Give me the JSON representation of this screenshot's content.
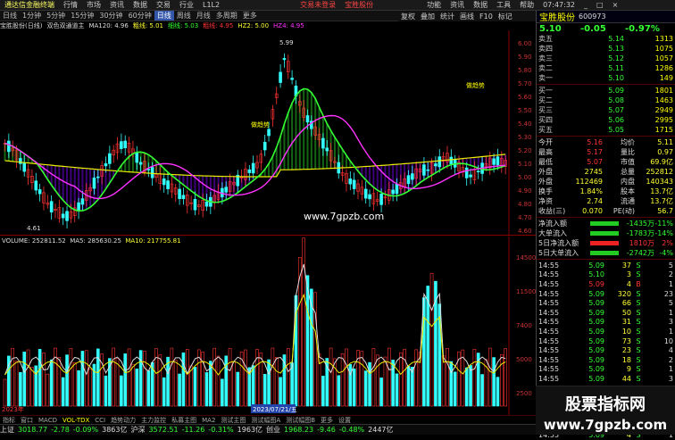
{
  "titlebar": {
    "app": "通达信金融终端",
    "menus": [
      "行情",
      "市场",
      "资讯",
      "数据",
      "交易",
      "行业",
      "L1L2"
    ],
    "promo1": "交易未登录",
    "promo2": "宝胜股份",
    "right_items": [
      "功能",
      "资讯",
      "数据",
      "工具",
      "帮助"
    ],
    "clock": "07:47:32"
  },
  "periodbar": {
    "items": [
      "日线",
      "1分钟",
      "5分钟",
      "15分钟",
      "30分钟",
      "60分钟",
      "日线",
      "周线",
      "月线",
      "多周期",
      "更多"
    ],
    "active_index": 6,
    "right_items": [
      "复权",
      "叠加",
      "统计",
      "画线",
      "F10",
      "标记"
    ]
  },
  "indicator_line": {
    "stock": "宝胜股份(日线)",
    "formula": "双色双通道主",
    "ma": "MA120: 4.96",
    "i1": "粗线: 5.01",
    "i2": "细线: 5.03",
    "i3": "粗线: 4.95",
    "i4": "HZ2: 5.00",
    "i5": "HZ4: 4.95"
  },
  "chart_labels": {
    "high": "5.99",
    "low": "4.61",
    "annot1": "做趋势",
    "annot2": "做趋势",
    "watermark": "www.7gpzb.com",
    "price_axis": [
      "6.00",
      "5.90",
      "5.80",
      "5.70",
      "5.60",
      "5.50",
      "5.40",
      "5.30",
      "5.20",
      "5.10",
      "5.00",
      "4.90",
      "4.80",
      "4.70",
      "4.60"
    ]
  },
  "volume": {
    "label": "VOLUME: 252811.52",
    "ma5": "MA5: 285630.25",
    "ma10": "MA10: 217755.81",
    "axis": [
      "14500",
      "11500",
      "7400",
      "5000",
      "2500"
    ],
    "axis_pos": [
      "14500",
      "1530",
      "11500",
      "10000",
      "7500",
      "5000",
      "2500"
    ],
    "date_label": "2023/07/21/五",
    "year": "2023年"
  },
  "bottom_tabs": [
    "指标",
    "窗口",
    "MACD",
    "VOL-TDX",
    "CCI",
    "趋势动力",
    "主力监控",
    "私募主图",
    "MA2",
    "测试主图",
    "测试幅图A",
    "测试幅图B",
    "更多",
    "设置"
  ],
  "bottom_tabs2": [
    "扩展A",
    "关联板块",
    "资金分布",
    "综合资讯",
    "行业资讯",
    "互动问答",
    "普及新功能说明"
  ],
  "statusbar": {
    "sh_label": "上证",
    "sh_val": "3018.77",
    "sh_chg": "-2.78",
    "sh_pct": "-0.09%",
    "sh_amt": "3863亿",
    "sz_label": "沪深",
    "sz_val": "3572.51",
    "sz_chg": "-11.26",
    "sz_pct": "-0.31%",
    "sz_amt": "1963亿",
    "cy_label": "创业",
    "cy_val": "1968.23",
    "cy_chg": "-9.46",
    "cy_pct": "-0.48%",
    "cy_amt": "2447亿",
    "right": "平安证券新疆云行情"
  },
  "quote": {
    "name": "宝胜股份",
    "code": "600973",
    "price": "5.10",
    "change": "-0.05",
    "pct": "-0.97%",
    "asks": [
      {
        "label": "卖五",
        "price": "5.14",
        "vol": "1313"
      },
      {
        "label": "卖四",
        "price": "5.13",
        "vol": "1075"
      },
      {
        "label": "卖三",
        "price": "5.12",
        "vol": "1057"
      },
      {
        "label": "卖二",
        "price": "5.11",
        "vol": "1286"
      },
      {
        "label": "卖一",
        "price": "5.10",
        "vol": "149"
      }
    ],
    "bids": [
      {
        "label": "买一",
        "price": "5.09",
        "vol": "1801"
      },
      {
        "label": "买二",
        "price": "5.08",
        "vol": "1463"
      },
      {
        "label": "买三",
        "price": "5.07",
        "vol": "2949"
      },
      {
        "label": "买四",
        "price": "5.06",
        "vol": "2995"
      },
      {
        "label": "买五",
        "price": "5.05",
        "vol": "1715"
      }
    ],
    "stats": [
      [
        "今开",
        "5.16",
        "均价",
        "5.11"
      ],
      [
        "最高",
        "5.17",
        "量比",
        "0.97"
      ],
      [
        "最低",
        "5.07",
        "市值",
        "69.9亿"
      ],
      [
        "外盘",
        "2745",
        "总量",
        "252812"
      ],
      [
        "外盘",
        "112469",
        "内盘",
        "140343"
      ],
      [
        "换手",
        "1.84%",
        "股本",
        "13.7亿"
      ],
      [
        "净资",
        "2.74",
        "流通",
        "13.7亿"
      ],
      [
        "收益(三)",
        "0.070",
        "PE(动)",
        "56.7"
      ]
    ],
    "flows": [
      {
        "label": "净流入额",
        "val": "-1435万",
        "pct": "-11%"
      },
      {
        "label": "大单流入",
        "val": "-1783万",
        "pct": "-14%"
      },
      {
        "label": "5日净流入额",
        "val": "1810万",
        "pct": "2%"
      },
      {
        "label": "5日大单流入",
        "val": "-2742万",
        "pct": "-4%"
      }
    ],
    "ticks": [
      [
        "14:55",
        "5.09",
        "37",
        "S",
        "5"
      ],
      [
        "14:55",
        "5.10",
        "3",
        "S",
        "2"
      ],
      [
        "14:55",
        "5.09",
        "4",
        "B",
        "1"
      ],
      [
        "14:55",
        "5.09",
        "320",
        "S",
        "23"
      ],
      [
        "14:55",
        "5.09",
        "66",
        "S",
        "5"
      ],
      [
        "14:55",
        "5.09",
        "50",
        "S",
        "1"
      ],
      [
        "14:55",
        "5.09",
        "31",
        "S",
        "3"
      ],
      [
        "14:55",
        "5.09",
        "10",
        "S",
        "1"
      ],
      [
        "14:55",
        "5.09",
        "73",
        "S",
        "10"
      ],
      [
        "14:55",
        "5.09",
        "23",
        "S",
        "4"
      ],
      [
        "14:55",
        "5.09",
        "18",
        "S",
        "2"
      ],
      [
        "14:55",
        "5.09",
        "9",
        "S",
        "1"
      ],
      [
        "14:55",
        "5.09",
        "44",
        "S",
        "3"
      ],
      [
        "14:55",
        "5.09",
        "17",
        "S",
        "3"
      ],
      [
        "14:55",
        "5.10",
        "93",
        "B",
        "10"
      ],
      [
        "14:55",
        "5.09",
        "117",
        "S",
        "9"
      ],
      [
        "14:55",
        "5.10",
        "1",
        "B",
        "1"
      ],
      [
        "14:55",
        "5.09",
        "126",
        "S",
        "4"
      ],
      [
        "14:55",
        "5.09",
        "4",
        "S",
        "1"
      ]
    ],
    "bottom_tabs": [
      "笔",
      "价",
      "细",
      "势",
      "联",
      "值",
      "主"
    ]
  },
  "logo": {
    "line1": "股票指标网",
    "line2": "www.7gpzb.com"
  }
}
